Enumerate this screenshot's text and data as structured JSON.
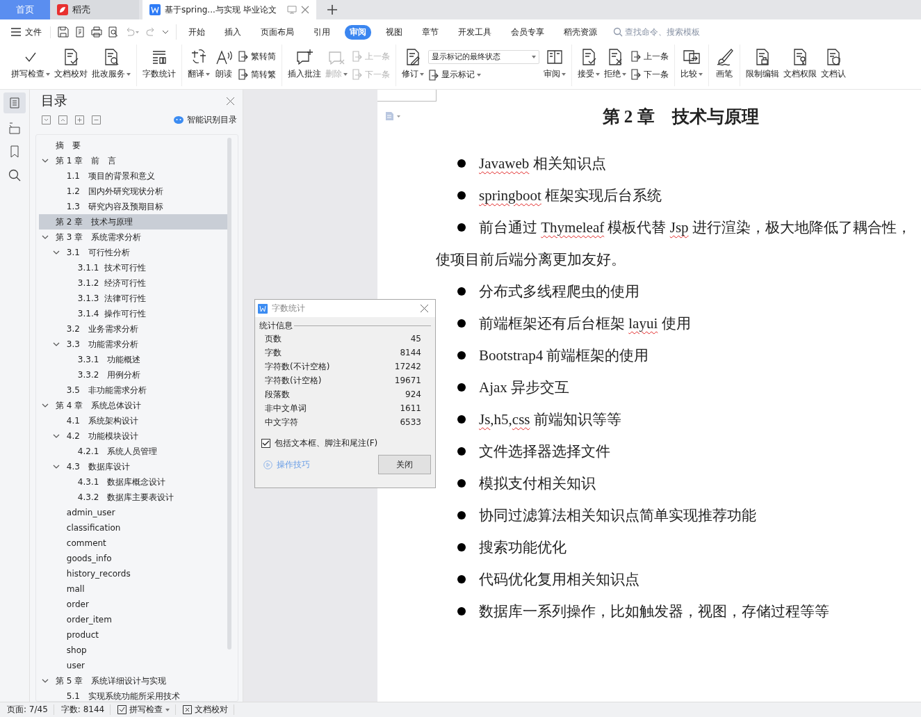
{
  "tabs": [
    {
      "label": "首页",
      "kind": "home",
      "selected": false
    },
    {
      "label": "稻壳",
      "kind": "app",
      "selected": false
    },
    {
      "label": "基于spring...与实现 毕业论文",
      "kind": "doc",
      "selected": true
    }
  ],
  "menu": {
    "file": "文件",
    "tabs": [
      {
        "label": "开始",
        "selected": false
      },
      {
        "label": "插入",
        "selected": false
      },
      {
        "label": "页面布局",
        "selected": false
      },
      {
        "label": "引用",
        "selected": false
      },
      {
        "label": "审阅",
        "selected": true
      },
      {
        "label": "视图",
        "selected": false
      },
      {
        "label": "章节",
        "selected": false
      },
      {
        "label": "开发工具",
        "selected": false
      },
      {
        "label": "会员专享",
        "selected": false
      },
      {
        "label": "稻壳资源",
        "selected": false
      }
    ],
    "search": {
      "placeholder": "查找命令、搜索模板"
    }
  },
  "ribbon": [
    [
      {
        "kind": "big",
        "label": "拼写检查",
        "dropdown": true,
        "disabled": false
      },
      {
        "kind": "big",
        "label": "文档校对",
        "dropdown": false,
        "disabled": false
      },
      {
        "kind": "big",
        "label": "批改服务",
        "dropdown": true,
        "disabled": false
      }
    ],
    [
      {
        "kind": "big",
        "label": "字数统计",
        "dropdown": false,
        "disabled": false
      }
    ],
    [
      {
        "kind": "big",
        "label": "翻译",
        "dropdown": true,
        "disabled": false
      },
      {
        "kind": "big",
        "label": "朗读",
        "dropdown": false,
        "disabled": false
      },
      {
        "kind": "stack",
        "items": [
          {
            "label": "繁转简",
            "disabled": false
          },
          {
            "label": "简转繁",
            "disabled": false
          }
        ]
      }
    ],
    [
      {
        "kind": "big",
        "label": "插入批注",
        "dropdown": false,
        "disabled": false
      },
      {
        "kind": "big",
        "label": "删除",
        "dropdown": true,
        "disabled": true
      },
      {
        "kind": "stack",
        "items": [
          {
            "label": "上一条",
            "disabled": true
          },
          {
            "label": "下一条",
            "disabled": true
          }
        ]
      }
    ],
    [
      {
        "kind": "big",
        "label": "修订",
        "dropdown": true,
        "disabled": false
      },
      {
        "kind": "select",
        "value": "显示标记的最终状态",
        "item": {
          "label": "显示标记",
          "dropdown": true
        }
      },
      {
        "kind": "big",
        "label": "审阅",
        "dropdown": true,
        "disabled": false
      }
    ],
    [
      {
        "kind": "big",
        "label": "接受",
        "dropdown": true,
        "disabled": false
      },
      {
        "kind": "big",
        "label": "拒绝",
        "dropdown": true,
        "disabled": false
      },
      {
        "kind": "stack",
        "items": [
          {
            "label": "上一条",
            "disabled": false
          },
          {
            "label": "下一条",
            "disabled": false
          }
        ]
      }
    ],
    [
      {
        "kind": "big",
        "label": "比较",
        "dropdown": true,
        "disabled": false
      }
    ],
    [
      {
        "kind": "big",
        "label": "画笔",
        "dropdown": false,
        "disabled": false
      }
    ],
    [
      {
        "kind": "big",
        "label": "限制编辑",
        "dropdown": false,
        "disabled": false
      },
      {
        "kind": "big",
        "label": "文档权限",
        "dropdown": false,
        "disabled": false
      },
      {
        "kind": "big",
        "label": "文档认",
        "dropdown": false,
        "disabled": false
      }
    ]
  ],
  "toc": {
    "title": "目录",
    "smart_button": "智能识别目录",
    "items": [
      {
        "label": "摘　要",
        "selected": false
      },
      {
        "label": "第 1 章　前　言",
        "selected": false,
        "expanded": true,
        "children": [
          {
            "label": "1.1　项目的背景和意义",
            "selected": false
          },
          {
            "label": "1.2　国内外研究现状分析",
            "selected": false
          },
          {
            "label": "1.3　研究内容及预期目标",
            "selected": false
          }
        ]
      },
      {
        "label": "第 2 章　技术与原理",
        "selected": true
      },
      {
        "label": "第 3 章　系统需求分析",
        "selected": false,
        "expanded": true,
        "children": [
          {
            "label": "3.1　可行性分析",
            "selected": false,
            "expanded": true,
            "children": [
              {
                "label": "3.1.1  技术可行性",
                "selected": false
              },
              {
                "label": "3.1.2  经济可行性",
                "selected": false
              },
              {
                "label": "3.1.3  法律可行性",
                "selected": false
              },
              {
                "label": "3.1.4  操作可行性",
                "selected": false
              }
            ]
          },
          {
            "label": "3.2　业务需求分析",
            "selected": false
          },
          {
            "label": "3.3　功能需求分析",
            "selected": false,
            "expanded": true,
            "children": [
              {
                "label": "3.3.1　功能概述",
                "selected": false
              },
              {
                "label": "3.3.2　用例分析",
                "selected": false
              }
            ]
          },
          {
            "label": "3.5　非功能需求分析",
            "selected": false
          }
        ]
      },
      {
        "label": "第 4 章　系统总体设计",
        "selected": false,
        "expanded": true,
        "children": [
          {
            "label": "4.1　系统架构设计",
            "selected": false
          },
          {
            "label": "4.2　功能模块设计",
            "selected": false,
            "expanded": true,
            "children": [
              {
                "label": "4.2.1　系统人员管理",
                "selected": false
              }
            ]
          },
          {
            "label": "4.3　数据库设计",
            "selected": false,
            "expanded": true,
            "children": [
              {
                "label": "4.3.1　数据库概念设计",
                "selected": false
              },
              {
                "label": "4.3.2　数据库主要表设计",
                "selected": false
              }
            ]
          },
          {
            "label": "admin_user",
            "selected": false
          },
          {
            "label": "classification",
            "selected": false
          },
          {
            "label": "comment",
            "selected": false
          },
          {
            "label": "goods_info",
            "selected": false
          },
          {
            "label": "history_records",
            "selected": false
          },
          {
            "label": "mall",
            "selected": false
          },
          {
            "label": "order",
            "selected": false
          },
          {
            "label": "order_item",
            "selected": false
          },
          {
            "label": "product",
            "selected": false
          },
          {
            "label": "shop",
            "selected": false
          },
          {
            "label": "user",
            "selected": false
          }
        ]
      },
      {
        "label": "第 5 章　系统详细设计与实现",
        "selected": false,
        "expanded": true,
        "children": [
          {
            "label": "5.1　实现系统功能所采用技术",
            "selected": false
          }
        ]
      }
    ]
  },
  "document": {
    "heading": "第 2 章　技术与原理",
    "bullets": [
      {
        "segments": [
          {
            "text": "Javaweb",
            "flagged": true
          },
          {
            "text": " 相关知识点",
            "flagged": false
          }
        ]
      },
      {
        "segments": [
          {
            "text": "springboot",
            "flagged": true
          },
          {
            "text": " 框架实现后台系统",
            "flagged": false
          }
        ]
      },
      {
        "segments": [
          {
            "text": "前台通过 ",
            "flagged": false
          },
          {
            "text": "Thymeleaf",
            "flagged": true
          },
          {
            "text": " 模板代替 ",
            "flagged": false
          },
          {
            "text": "Jsp",
            "flagged": true
          },
          {
            "text": " 进行渲染，极大地降低了耦合性，",
            "flagged": false
          }
        ],
        "continuation": "使项目前后端分离更加友好。"
      },
      {
        "segments": [
          {
            "text": "分布式多线程爬虫的使用",
            "flagged": false
          }
        ]
      },
      {
        "segments": [
          {
            "text": "前端框架还有后台框架 ",
            "flagged": false
          },
          {
            "text": "layui",
            "flagged": true
          },
          {
            "text": " 使用",
            "flagged": false
          }
        ]
      },
      {
        "segments": [
          {
            "text": "Bootstrap4 前端框架的使用",
            "flagged": false
          }
        ]
      },
      {
        "segments": [
          {
            "text": "Ajax 异步交互",
            "flagged": false
          }
        ]
      },
      {
        "segments": [
          {
            "text": "Js",
            "flagged": true
          },
          {
            "text": ",h5,",
            "flagged": false
          },
          {
            "text": "css",
            "flagged": true
          },
          {
            "text": " 前端知识等等",
            "flagged": false
          }
        ]
      },
      {
        "segments": [
          {
            "text": "文件选择器选择文件",
            "flagged": false
          }
        ]
      },
      {
        "segments": [
          {
            "text": "模拟支付相关知识",
            "flagged": false
          }
        ]
      },
      {
        "segments": [
          {
            "text": "协同过滤算法相关知识点简单实现推荐功能",
            "flagged": false
          }
        ]
      },
      {
        "segments": [
          {
            "text": "搜索功能优化",
            "flagged": false
          }
        ]
      },
      {
        "segments": [
          {
            "text": "代码优化复用相关知识点",
            "flagged": false
          }
        ]
      },
      {
        "segments": [
          {
            "text": "数据库一系列操作，比如触发器，视图，存储过程等等",
            "flagged": false
          }
        ]
      }
    ]
  },
  "dialog": {
    "title": "字数统计",
    "section": "统计信息",
    "rows": [
      {
        "label": "页数",
        "value": "45"
      },
      {
        "label": "字数",
        "value": "8144"
      },
      {
        "label": "字符数(不计空格)",
        "value": "17242"
      },
      {
        "label": "字符数(计空格)",
        "value": "19671"
      },
      {
        "label": "段落数",
        "value": "924"
      },
      {
        "label": "非中文单词",
        "value": "1611"
      },
      {
        "label": "中文字符",
        "value": "6533"
      }
    ],
    "checkbox": {
      "label": "包括文本框、脚注和尾注(F)",
      "checked": true
    },
    "tips_link": "操作技巧",
    "close_button": "关闭"
  },
  "status_bar": {
    "page": "页面: 7/45",
    "words": "字数: 8144",
    "spell_check": "拼写检查",
    "proofread": "文档校对"
  }
}
